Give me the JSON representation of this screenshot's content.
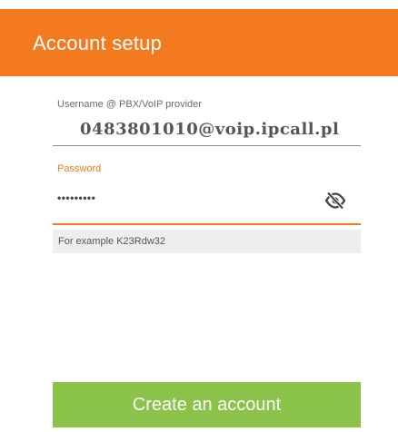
{
  "appbar": {
    "title": "Account setup",
    "color": "#f47a20"
  },
  "form": {
    "username": {
      "label": "Username @ PBX/VoIP provider",
      "value": "0483801010@voip.ipcall.pl"
    },
    "password": {
      "label": "Password",
      "value": "•••••••••",
      "toggle_icon": "visibility-off-icon",
      "hint": "For example K23Rdw32",
      "accent_color": "#f47a20"
    }
  },
  "actions": {
    "create_account_label": "Create an account",
    "button_color": "#8bc34a"
  }
}
